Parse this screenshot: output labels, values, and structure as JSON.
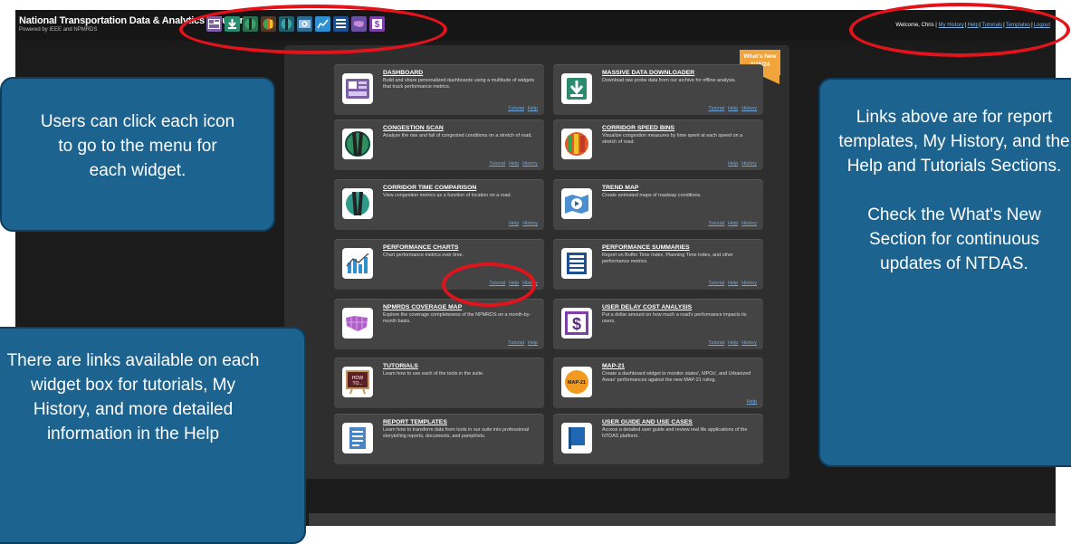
{
  "header": {
    "title": "National Transportation Data & Analytics Solution",
    "subtitle": "Powered by IEEE and NPMRDS",
    "welcome": "Welcome, Chris |",
    "links": [
      "My History",
      "Help",
      "Tutorials",
      "Templates",
      "Logout"
    ]
  },
  "toolbar_icons": [
    "dashboard-icon",
    "downloader-icon",
    "congestion-scan-icon",
    "speed-bins-icon",
    "time-comparison-icon",
    "trend-map-icon",
    "performance-charts-icon",
    "performance-summaries-icon",
    "coverage-map-icon",
    "user-delay-cost-icon"
  ],
  "whats_new": {
    "label": "What's New",
    "date": "3/15/24"
  },
  "cards": [
    {
      "title": "DASHBOARD",
      "desc": "Build and share personalized dashboards using a multitude of widgets that track performance metrics.",
      "links": [
        "Tutorial",
        "Help"
      ],
      "icon": "dashboard-icon"
    },
    {
      "title": "MASSIVE DATA DOWNLOADER",
      "desc": "Download raw probe data from our archive for offline analysis.",
      "links": [
        "Tutorial",
        "Help",
        "History"
      ],
      "icon": "download-icon"
    },
    {
      "title": "CONGESTION SCAN",
      "desc": "Analyze the rise and fall of congested conditions on a stretch of road.",
      "links": [
        "Tutorial",
        "Help",
        "History"
      ],
      "icon": "road-globe-icon"
    },
    {
      "title": "CORRIDOR SPEED BINS",
      "desc": "Visualize congestion measures by time spent at each speed on a stretch of road.",
      "links": [
        "Help",
        "History"
      ],
      "icon": "speed-bins-icon"
    },
    {
      "title": "CORRIDOR TIME COMPARISON",
      "desc": "View congestion metrics as a function of location on a road.",
      "links": [
        "Help",
        "History"
      ],
      "icon": "corridor-globe-icon"
    },
    {
      "title": "TREND MAP",
      "desc": "Create animated maps of roadway conditions.",
      "links": [
        "Tutorial",
        "Help",
        "History"
      ],
      "icon": "map-play-icon"
    },
    {
      "title": "PERFORMANCE CHARTS",
      "desc": "Chart performance metrics over time.",
      "links": [
        "Tutorial",
        "Help",
        "History"
      ],
      "icon": "bar-chart-icon"
    },
    {
      "title": "PERFORMANCE SUMMARIES",
      "desc": "Report on Buffer Time Index, Planning Time Index, and other performance metrics.",
      "links": [
        "Tutorial",
        "Help",
        "History"
      ],
      "icon": "table-icon"
    },
    {
      "title": "NPMRDS COVERAGE MAP",
      "desc": "Explore the coverage completeness of the NPMRDS on a month-by-month basis.",
      "links": [
        "Tutorial",
        "Help"
      ],
      "icon": "us-map-icon"
    },
    {
      "title": "USER DELAY COST ANALYSIS",
      "desc": "Put a dollar amount on how much a road's performance impacts its users.",
      "links": [
        "Tutorial",
        "Help",
        "History"
      ],
      "icon": "dollar-icon"
    },
    {
      "title": "TUTORIALS",
      "desc": "Learn how to use each of the tools in the suite.",
      "links": [],
      "icon": "chalkboard-icon"
    },
    {
      "title": "MAP-21",
      "desc": "Create a dashboard widget to monitor states', MPOs', and Urbanized Areas' performances against the new MAP-21 ruling.",
      "links": [
        "Help"
      ],
      "icon": "map21-icon"
    },
    {
      "title": "REPORT TEMPLATES",
      "desc": "Learn how to transform data from tools in our suite into professional storytelling reports, documents, and pamphlets.",
      "links": [],
      "icon": "document-icon"
    },
    {
      "title": "USER GUIDE AND USE CASES",
      "desc": "Access a detailed user guide and review real life applications of the NTDAS platform.",
      "links": [],
      "icon": "book-icon"
    }
  ],
  "callouts": {
    "icons": "Users can click each icon to go to the menu for each widget.",
    "links": "There are links available on each widget box for tutorials, My History, and more detailed information in the Help",
    "header_links": "Links above are for report templates, My History, and the Help and Tutorials Sections.",
    "whats_new": "Check the What's New Section for continuous updates of NTDAS."
  },
  "colors": {
    "accent": "#e3131b",
    "callout": "#1c6390",
    "link": "#6ea8df",
    "ribbon": "#f0a43a"
  }
}
